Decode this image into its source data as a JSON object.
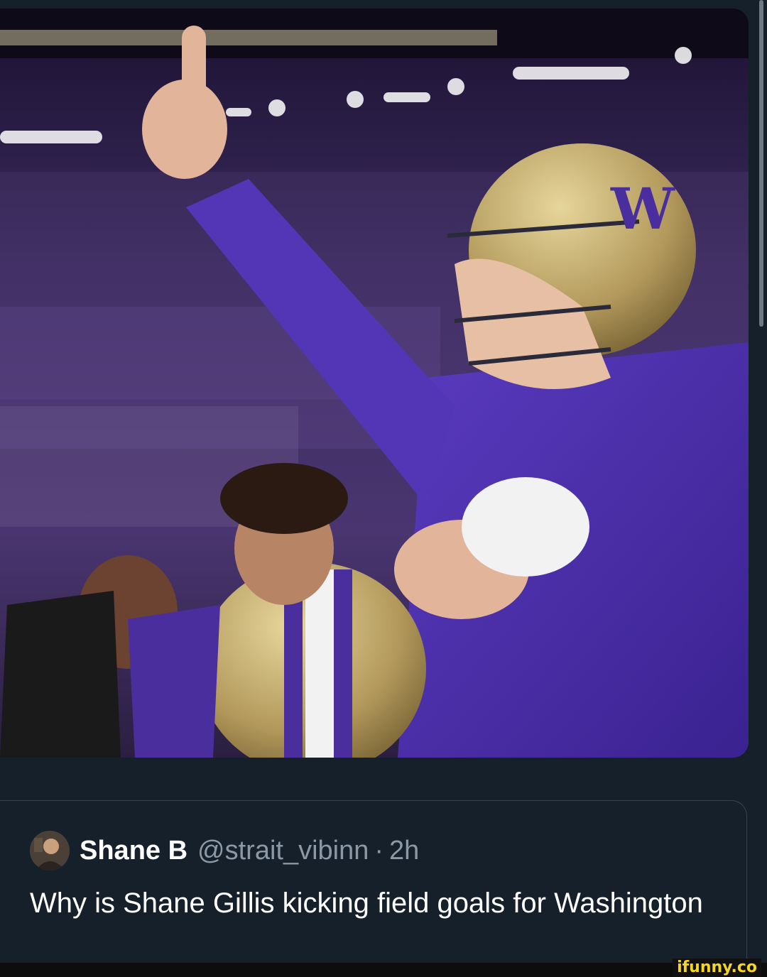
{
  "post": {
    "author": {
      "display_name": "Shane B",
      "handle": "@strait_vibinn",
      "separator": "·",
      "time": "2h"
    },
    "text": "Why is Shane Gillis kicking field goals for Washington"
  },
  "watermark": "ifunny.co",
  "colors": {
    "background": "#15202b",
    "border": "#38444d",
    "muted_text": "#8b98a5",
    "jersey_purple": "#4b2e9e",
    "helmet_gold": "#b7a36a",
    "watermark_yellow": "#f5d422"
  },
  "icons": {
    "avatar": "user-avatar-photo"
  }
}
